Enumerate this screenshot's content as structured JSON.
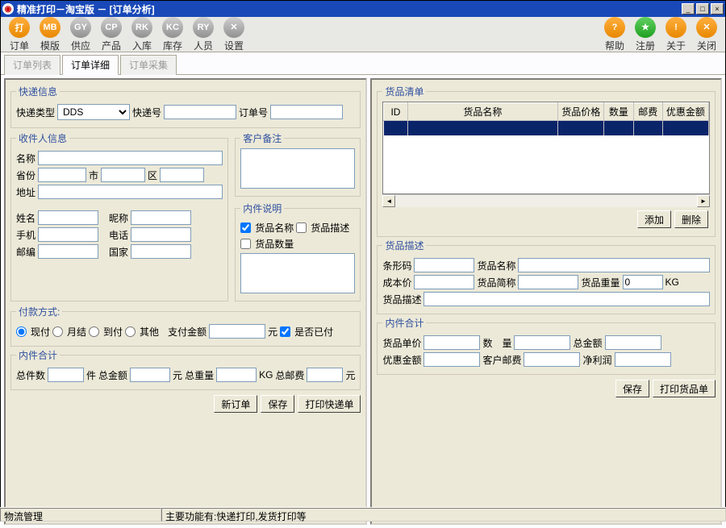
{
  "title": "精准打印－淘宝版 － [订单分析]",
  "toolbar": [
    {
      "icon": "打",
      "label": "订单",
      "cls": "ic-orange"
    },
    {
      "icon": "MB",
      "label": "模版",
      "cls": "ic-orange"
    },
    {
      "icon": "GY",
      "label": "供应",
      "cls": "ic-gray"
    },
    {
      "icon": "CP",
      "label": "产品",
      "cls": "ic-gray"
    },
    {
      "icon": "RK",
      "label": "入库",
      "cls": "ic-gray"
    },
    {
      "icon": "KC",
      "label": "库存",
      "cls": "ic-gray"
    },
    {
      "icon": "RY",
      "label": "人员",
      "cls": "ic-gray"
    },
    {
      "icon": "✕",
      "label": "设置",
      "cls": "ic-gray"
    }
  ],
  "toolbar_right": [
    {
      "icon": "?",
      "label": "帮助",
      "cls": "ic-help"
    },
    {
      "icon": "★",
      "label": "注册",
      "cls": "ic-reg"
    },
    {
      "icon": "!",
      "label": "关于",
      "cls": "ic-about"
    },
    {
      "icon": "✕",
      "label": "关闭",
      "cls": "ic-close"
    }
  ],
  "tabs": [
    "订单列表",
    "订单详细",
    "订单采集"
  ],
  "active_tab": 1,
  "left": {
    "express_info": {
      "legend": "快递信息",
      "type_label": "快递类型",
      "type_value": "DDS",
      "number_label": "快递号",
      "order_label": "订单号"
    },
    "recipient": {
      "legend": "收件人信息",
      "name": "名称",
      "province": "省份",
      "city": "市",
      "district": "区",
      "address": "地址",
      "realname": "姓名",
      "nickname": "昵称",
      "mobile": "手机",
      "phone": "电话",
      "zip": "邮编",
      "country": "国家"
    },
    "customer_note": "客户备注",
    "inner_desc": {
      "legend": "内件说明",
      "product_name": "货品名称",
      "product_desc": "货品描述",
      "product_qty": "货品数量"
    },
    "payment": {
      "legend": "付款方式:",
      "cash": "现付",
      "monthly": "月结",
      "cod": "到付",
      "other": "其他",
      "amount_label": "支付金额",
      "unit": "元",
      "paid": "是否已付"
    },
    "totals": {
      "legend": "内件合计",
      "count": "总件数",
      "count_unit": "件",
      "amount": "总金额",
      "amount_unit": "元",
      "weight": "总重量",
      "weight_unit": "KG",
      "postage": "总邮费",
      "postage_unit": "元"
    },
    "buttons": {
      "new": "新订单",
      "save": "保存",
      "print": "打印快递单"
    }
  },
  "right": {
    "list": {
      "legend": "货品清单",
      "headers": [
        "ID",
        "货品名称",
        "货品价格",
        "数量",
        "邮费",
        "优惠金额"
      ],
      "add": "添加",
      "delete": "删除"
    },
    "desc": {
      "legend": "货品描述",
      "barcode": "条形码",
      "name": "货品名称",
      "cost": "成本价",
      "short": "货品简称",
      "weight": "货品重量",
      "weight_val": "0",
      "weight_unit": "KG",
      "detail": "货品描述"
    },
    "totals": {
      "legend": "内件合计",
      "price": "货品单价",
      "qty": "数　量",
      "total": "总金额",
      "discount": "优惠金额",
      "postage": "客户邮费",
      "profit": "净利润"
    },
    "buttons": {
      "save": "保存",
      "print": "打印货品单"
    }
  },
  "status": {
    "left": "物流管理",
    "right": "主要功能有:快递打印,发货打印等"
  }
}
